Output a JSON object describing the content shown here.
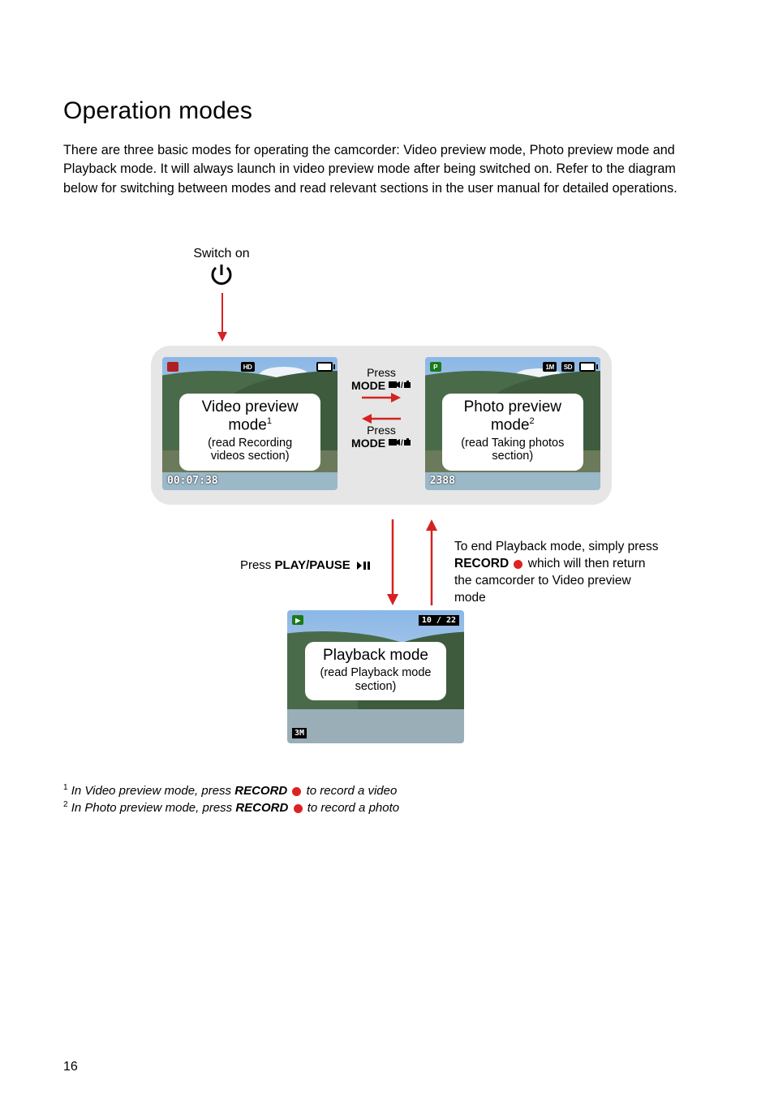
{
  "heading": "Operation modes",
  "intro": "There are three basic modes for operating the camcorder: Video preview mode, Photo preview mode and Playback mode. It will always launch in video preview mode after being switched on. Refer to the diagram below for switching between modes and read relevant sections in the user manual for detailed operations.",
  "switch_on": "Switch on",
  "video_screen": {
    "hd_badge": "HD",
    "timecode": "00:07:38",
    "caption_title_pre": "Video preview mode",
    "caption_sup": "1",
    "caption_sub": "(read Recording videos section)"
  },
  "photo_screen": {
    "res_badge": "1M",
    "sd_badge": "SD",
    "counter": "2388",
    "caption_title_pre": "Photo preview mode",
    "caption_sup": "2",
    "caption_sub": "(read Taking photos section)"
  },
  "playback_screen": {
    "tr_counter": "10 / 22",
    "bl_badge": "3M",
    "caption_title": "Playback mode",
    "caption_sub": "(read Playback mode section)"
  },
  "mode_arrows": {
    "press": "Press",
    "mode_label": "MODE"
  },
  "below": {
    "press": "Press ",
    "playpause": "PLAY/PAUSE",
    "right_line1": "To end Playback mode, simply press ",
    "record": "RECORD",
    "right_line2": "  which will then return the camcorder to Video preview mode"
  },
  "footnote1_pre": " In Video preview mode, press ",
  "footnote1_post": " to record a video",
  "footnote2_pre": " In Photo preview mode, press ",
  "footnote2_post": " to record a photo",
  "footnote_record": "RECORD",
  "page_number": "16"
}
